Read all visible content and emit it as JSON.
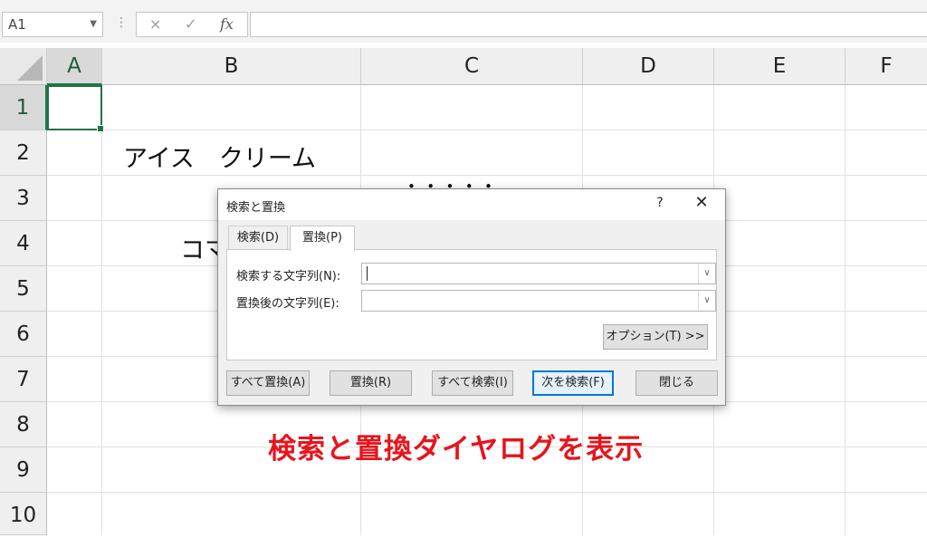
{
  "formula_bar": {
    "name_box": "A1",
    "cancel_icon": "×",
    "enter_icon": "✓",
    "fx_label": "fx",
    "formula_value": ""
  },
  "sheet": {
    "columns": [
      "A",
      "B",
      "C",
      "D",
      "E",
      "F"
    ],
    "rows": [
      "1",
      "2",
      "3",
      "4",
      "5",
      "6",
      "7",
      "8",
      "9",
      "10"
    ],
    "cells": {
      "B2": "アイス　クリーム",
      "C3_partial": "･ ･ ･ ･ ･",
      "B4_partial": "コマ"
    },
    "accent": "#217346"
  },
  "dialog": {
    "title": "検索と置換",
    "help": "?",
    "close": "✕",
    "tabs": {
      "find": "検索(D)",
      "replace": "置換(P)"
    },
    "find_label": "検索する文字列(N):",
    "find_value": "",
    "replace_label": "置換後の文字列(E):",
    "replace_value": "",
    "options_button": "オプション(T) >>",
    "buttons": {
      "replace_all": "すべて置換(A)",
      "replace": "置換(R)",
      "find_all": "すべて検索(I)",
      "find_next": "次を検索(F)",
      "close": "閉じる"
    }
  },
  "annotation": {
    "text": "検索と置換ダイヤログを表示",
    "color": "#e8141c"
  }
}
